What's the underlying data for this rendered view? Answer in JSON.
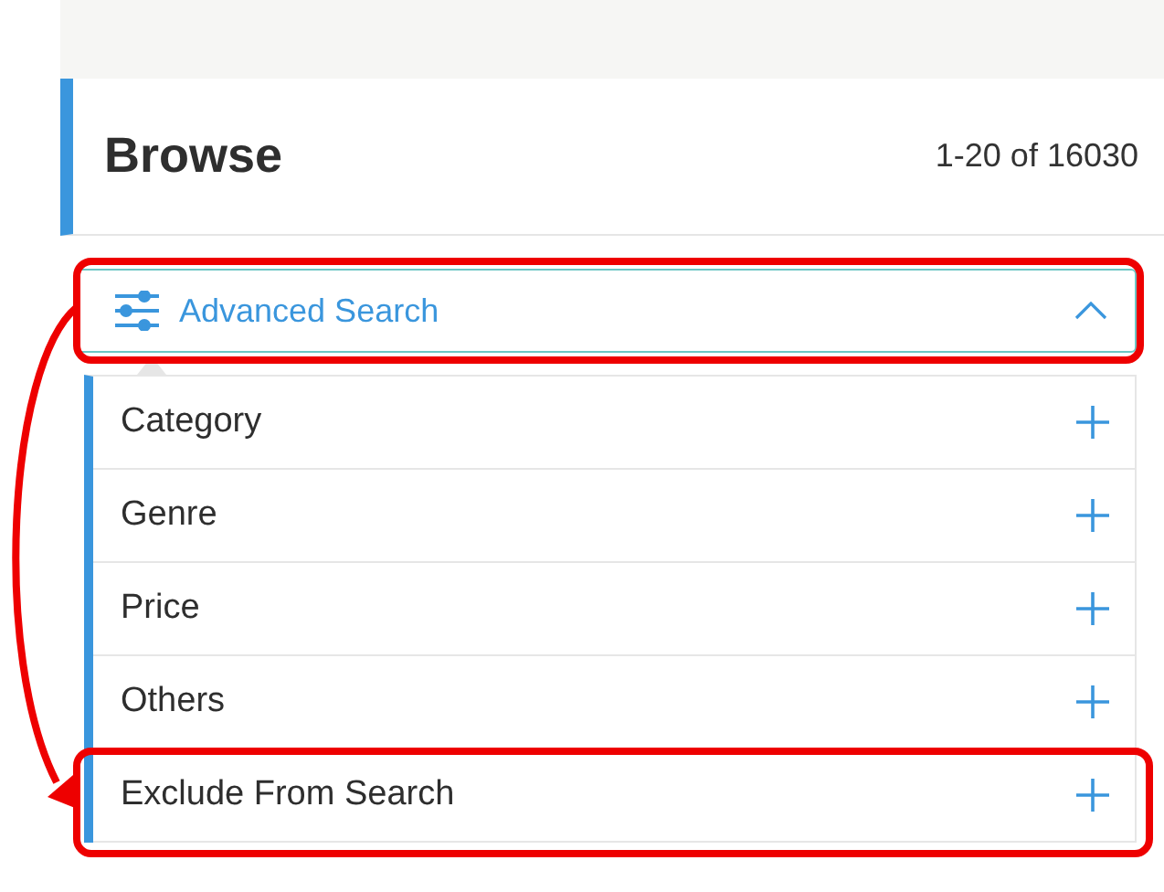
{
  "header": {
    "title": "Browse",
    "count": "1-20 of 16030"
  },
  "advanced_search": {
    "label": "Advanced Search",
    "expanded": true
  },
  "filters": [
    {
      "label": "Category",
      "expanded": false
    },
    {
      "label": "Genre",
      "expanded": false
    },
    {
      "label": "Price",
      "expanded": false
    },
    {
      "label": "Others",
      "expanded": false
    },
    {
      "label": "Exclude From Search",
      "expanded": false
    }
  ]
}
